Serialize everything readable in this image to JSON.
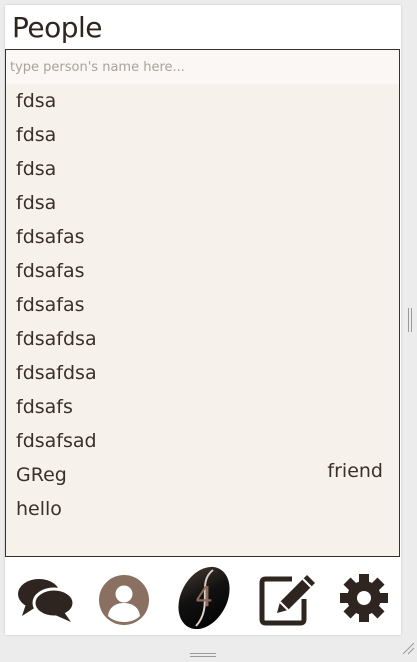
{
  "header": {
    "title": "People"
  },
  "search": {
    "placeholder": "type person's name here...",
    "value": ""
  },
  "people": [
    {
      "name": "fdsa",
      "relation": ""
    },
    {
      "name": "fdsa",
      "relation": ""
    },
    {
      "name": "fdsa",
      "relation": ""
    },
    {
      "name": "fdsa",
      "relation": ""
    },
    {
      "name": "fdsafas",
      "relation": ""
    },
    {
      "name": "fdsafas",
      "relation": ""
    },
    {
      "name": "fdsafas",
      "relation": ""
    },
    {
      "name": "fdsafdsa",
      "relation": ""
    },
    {
      "name": "fdsafdsa",
      "relation": ""
    },
    {
      "name": "fdsafs",
      "relation": ""
    },
    {
      "name": "fdsafsad",
      "relation": ""
    },
    {
      "name": "GReg",
      "relation": "friend"
    },
    {
      "name": "hello",
      "relation": ""
    }
  ],
  "toolbar": {
    "icons": [
      "chat-bubbles-icon",
      "profile-icon",
      "coffee-bean-icon",
      "compose-icon",
      "gear-icon"
    ],
    "badge_count": "4"
  },
  "colors": {
    "text": "#3a2f29",
    "list_background": "#f7f1ec",
    "profile_icon": "#8a7060",
    "icon_dark": "#2e2520"
  }
}
